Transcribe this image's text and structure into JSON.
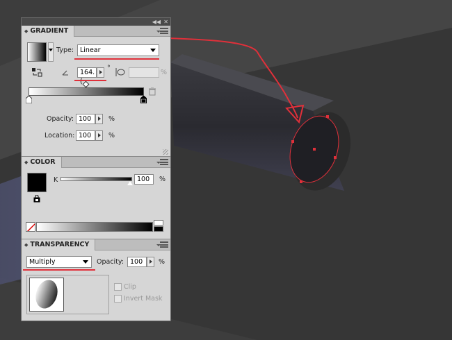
{
  "gradient": {
    "tab_label": "GRADIENT",
    "type_label": "Type:",
    "type_value": "Linear",
    "angle_value": "164.(",
    "degree_symbol": "°",
    "aspect_unit": "%",
    "opacity_label": "Opacity:",
    "opacity_value": "100",
    "opacity_unit": "%",
    "location_label": "Location:",
    "location_value": "100",
    "location_unit": "%"
  },
  "color": {
    "tab_label": "COLOR",
    "channel_label": "K",
    "channel_value": "100",
    "channel_unit": "%"
  },
  "transparency": {
    "tab_label": "TRANSPARENCY",
    "blend_mode": "Multiply",
    "opacity_label": "Opacity:",
    "opacity_value": "100",
    "opacity_unit": "%",
    "clip_label": "Clip",
    "invert_mask_label": "Invert Mask"
  },
  "colors": {
    "annotation": "#e0303a",
    "panel_bg": "#d6d6d6",
    "artboard": "#3c3c3c"
  },
  "icons": [
    "collapse-icon",
    "close-icon",
    "panel-menu-icon",
    "reverse-gradient-icon",
    "angle-icon",
    "aspect-ratio-icon",
    "trash-icon",
    "out-of-gamut-icon",
    "none-swatch-icon"
  ]
}
